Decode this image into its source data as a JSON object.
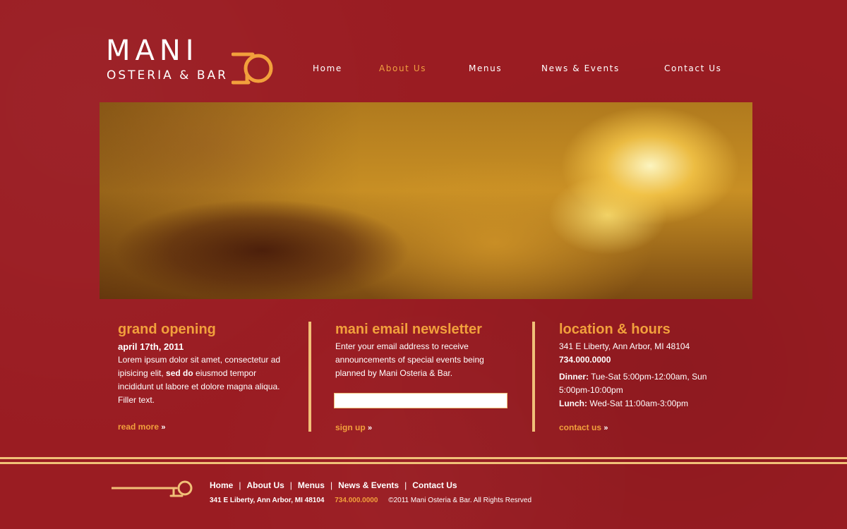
{
  "logo": {
    "name": "MANI",
    "sub": "OSTERIA & BAR"
  },
  "nav": [
    {
      "label": "Home",
      "active": false
    },
    {
      "label": "About Us",
      "active": true
    },
    {
      "label": "Menus",
      "active": false
    },
    {
      "label": "News & Events",
      "active": false
    },
    {
      "label": "Contact Us",
      "active": false
    }
  ],
  "columns": {
    "opening": {
      "title": "grand opening",
      "date": "april 17th, 2011",
      "body_pre": "Lorem ipsum dolor sit amet, consectetur ad ipisicing elit, ",
      "body_bold": "sed do",
      "body_post": " eiusmod tempor incididunt ut labore et dolore magna aliqua. Filler text.",
      "more": "read more",
      "more_arrow": "»"
    },
    "newsletter": {
      "title": "mani email newsletter",
      "body": "Enter your email address to receive announcements of special events being planned by Mani Osteria & Bar.",
      "input_value": "",
      "more": "sign up",
      "more_arrow": "»"
    },
    "location": {
      "title": "location & hours",
      "address": "341 E Liberty, Ann Arbor, MI 48104",
      "phone": "734.000.0000",
      "dinner_label": "Dinner:",
      "dinner_hours": " Tue-Sat 5:00pm-12:00am, Sun 5:00pm-10:00pm",
      "lunch_label": "Lunch:",
      "lunch_hours": " Wed-Sat 11:00am-3:00pm",
      "more": "contact us",
      "more_arrow": "»"
    }
  },
  "footer": {
    "links": [
      "Home",
      "About Us",
      "Menus",
      "News & Events",
      "Contact Us"
    ],
    "separator": "|",
    "address": "341 E Liberty, Ann Arbor, MI 48104",
    "phone": "734.000.0000",
    "copyright": "©2011 Mani Osteria & Bar. All Rights Resrved"
  },
  "colors": {
    "background": "#9a1c22",
    "accent": "#f2a03c",
    "rule": "#f1c078"
  }
}
